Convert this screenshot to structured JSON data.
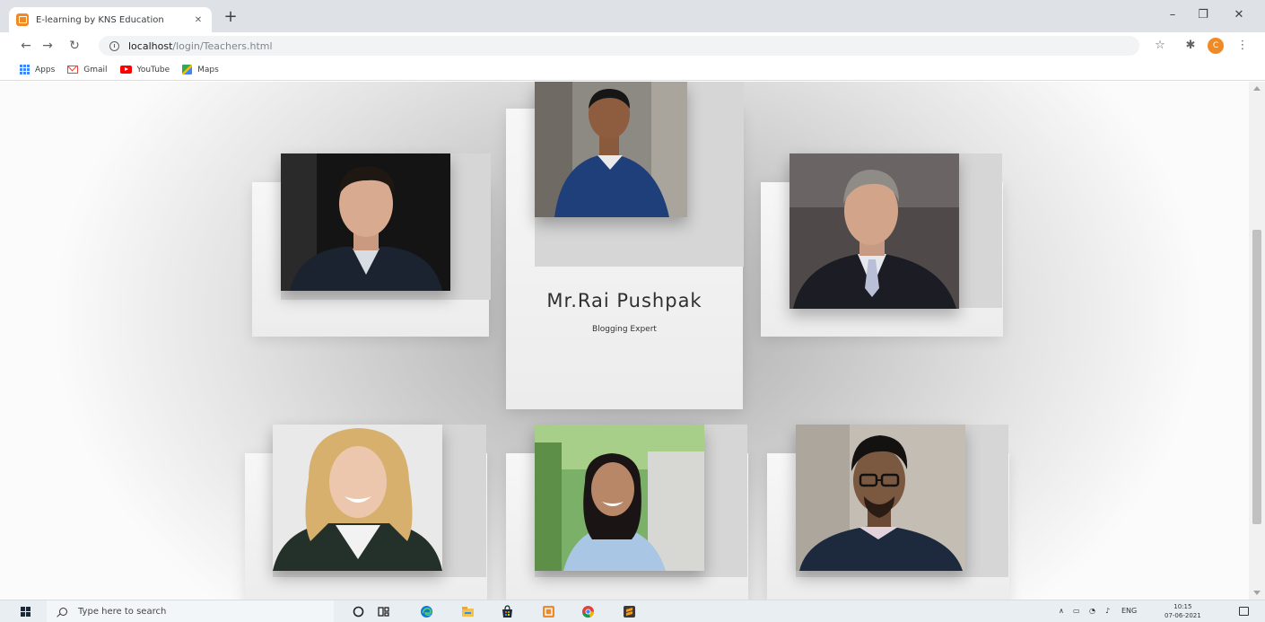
{
  "browser": {
    "tab_title": "E-learning by KNS Education",
    "tab_close": "✕",
    "new_tab": "+",
    "url_host": "localhost",
    "url_path": "/login/Teachers.html",
    "bookmarks": [
      "Apps",
      "Gmail",
      "YouTube",
      "Maps"
    ],
    "profile_initial": "C"
  },
  "teachers": {
    "featured": {
      "name": "Mr.Rai Pushpak",
      "role": "Blogging Expert"
    }
  },
  "taskbar": {
    "search_placeholder": "Type here to search",
    "language": "ENG",
    "time": "10:15",
    "date": "07-06-2021"
  }
}
